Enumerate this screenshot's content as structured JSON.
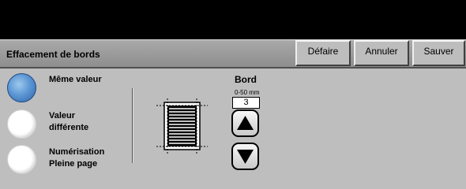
{
  "header": {
    "title": "Effacement de bords",
    "buttons": {
      "undo": "Défaire",
      "cancel": "Annuler",
      "save": "Sauver"
    }
  },
  "options": {
    "same_value": "Même valeur",
    "different_value_line1": "Valeur",
    "different_value_line2": "différente",
    "full_scan_line1": "Numérisation",
    "full_scan_line2": "Pleine page",
    "selected": "same_value"
  },
  "border": {
    "label": "Bord",
    "range": "0-50 mm",
    "value": "3"
  },
  "colors": {
    "top_bar": "#000000",
    "background": "#bebebe",
    "selected_radio": "#5d98d4"
  },
  "icons": {
    "up": "arrow-up-icon",
    "down": "arrow-down-icon",
    "document": "document-border-icon"
  }
}
